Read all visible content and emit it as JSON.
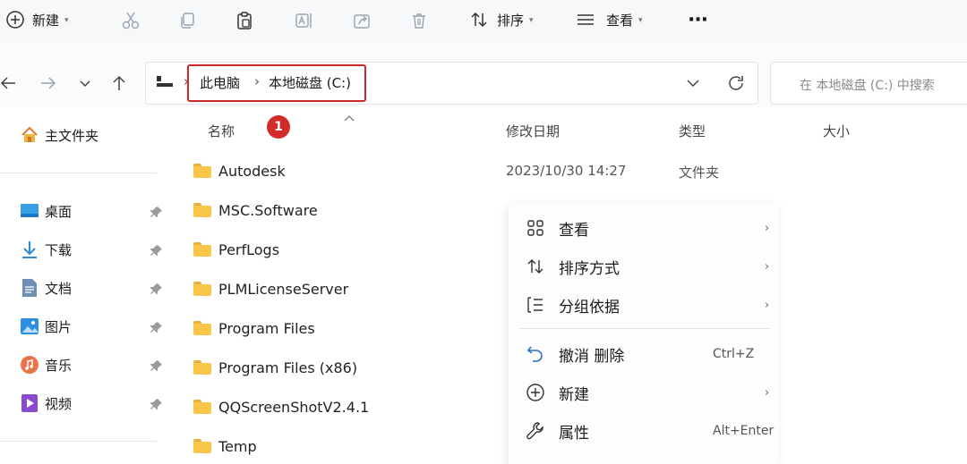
{
  "toolbar": {
    "new_label": "新建",
    "sort_label": "排序",
    "view_label": "查看",
    "more_label": "···"
  },
  "address": {
    "segments": [
      "此电脑",
      "本地磁盘 (C:)"
    ],
    "separator": "›"
  },
  "search": {
    "placeholder": "在 本地磁盘 (C:) 中搜索"
  },
  "sidebar": {
    "home": "主文件夹",
    "items": [
      {
        "label": "桌面",
        "icon": "desktop-icon"
      },
      {
        "label": "下载",
        "icon": "download-icon"
      },
      {
        "label": "文档",
        "icon": "document-icon"
      },
      {
        "label": "图片",
        "icon": "picture-icon"
      },
      {
        "label": "音乐",
        "icon": "music-icon"
      },
      {
        "label": "视频",
        "icon": "video-icon"
      }
    ]
  },
  "columns": {
    "name": "名称",
    "modified": "修改日期",
    "type": "类型",
    "size": "大小"
  },
  "annotation": {
    "badge": "1",
    "color": "#cc2a2a"
  },
  "files": [
    {
      "name": "Autodesk",
      "modified": "2023/10/30 14:27",
      "type": "文件夹"
    },
    {
      "name": "MSC.Software"
    },
    {
      "name": "PerfLogs"
    },
    {
      "name": "PLMLicenseServer"
    },
    {
      "name": "Program Files"
    },
    {
      "name": "Program Files (x86)"
    },
    {
      "name": "QQScreenShotV2.4.1"
    },
    {
      "name": "Temp"
    }
  ],
  "context_menu": {
    "items": [
      {
        "label": "查看",
        "icon": "grid-view-icon",
        "submenu": true
      },
      {
        "label": "排序方式",
        "icon": "sort-icon",
        "submenu": true
      },
      {
        "label": "分组依据",
        "icon": "group-icon",
        "submenu": true
      },
      {
        "label": "撤消 删除",
        "icon": "undo-icon",
        "shortcut": "Ctrl+Z"
      },
      {
        "label": "新建",
        "icon": "new-icon",
        "submenu": true
      },
      {
        "label": "属性",
        "icon": "wrench-icon",
        "shortcut": "Alt+Enter"
      }
    ]
  }
}
